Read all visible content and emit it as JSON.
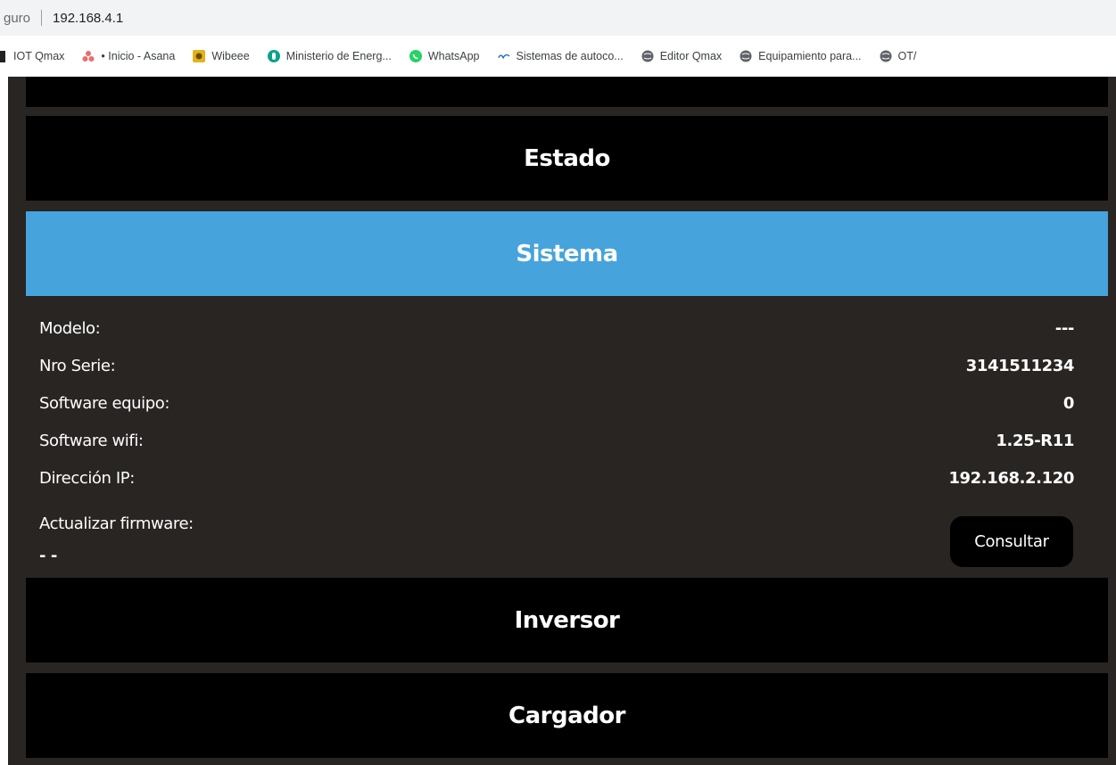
{
  "browser": {
    "security_text": "guro",
    "url": "192.168.4.1",
    "bookmarks": [
      {
        "label": "IOT Qmax",
        "icon": "app-icon",
        "color": "#202124"
      },
      {
        "label": "• Inicio - Asana",
        "icon": "asana-icon",
        "color": "#f06a6a"
      },
      {
        "label": "Wibeee",
        "icon": "wibeee-icon",
        "color": "#e3b21b"
      },
      {
        "label": "Ministerio de Energ...",
        "icon": "ministerio-icon",
        "color": "#0aa38a"
      },
      {
        "label": "WhatsApp",
        "icon": "whatsapp-icon",
        "color": "#25d366"
      },
      {
        "label": "Sistemas de autoco...",
        "icon": "sistemas-icon",
        "color": "#1a6fd1"
      },
      {
        "label": "Editor Qmax",
        "icon": "globe-icon",
        "color": "#5f6368"
      },
      {
        "label": "Equipamiento para...",
        "icon": "globe-icon",
        "color": "#5f6368"
      },
      {
        "label": "OT/",
        "icon": "globe-icon",
        "color": "#5f6368"
      }
    ]
  },
  "sections": {
    "estado": "Estado",
    "sistema": "Sistema",
    "inversor": "Inversor",
    "cargador": "Cargador"
  },
  "sistema": {
    "rows": [
      {
        "label": "Modelo:",
        "value": "---"
      },
      {
        "label": "Nro Serie:",
        "value": "3141511234"
      },
      {
        "label": "Software equipo:",
        "value": "0"
      },
      {
        "label": "Software wifi:",
        "value": "1.25-R11"
      },
      {
        "label": "Dirección IP:",
        "value": "192.168.2.120"
      }
    ],
    "firmware_label": "Actualizar firmware:",
    "firmware_status": "- -",
    "consultar_label": "Consultar"
  },
  "colors": {
    "background": "#282523",
    "panel": "#000000",
    "active_panel": "#46a3dc"
  }
}
